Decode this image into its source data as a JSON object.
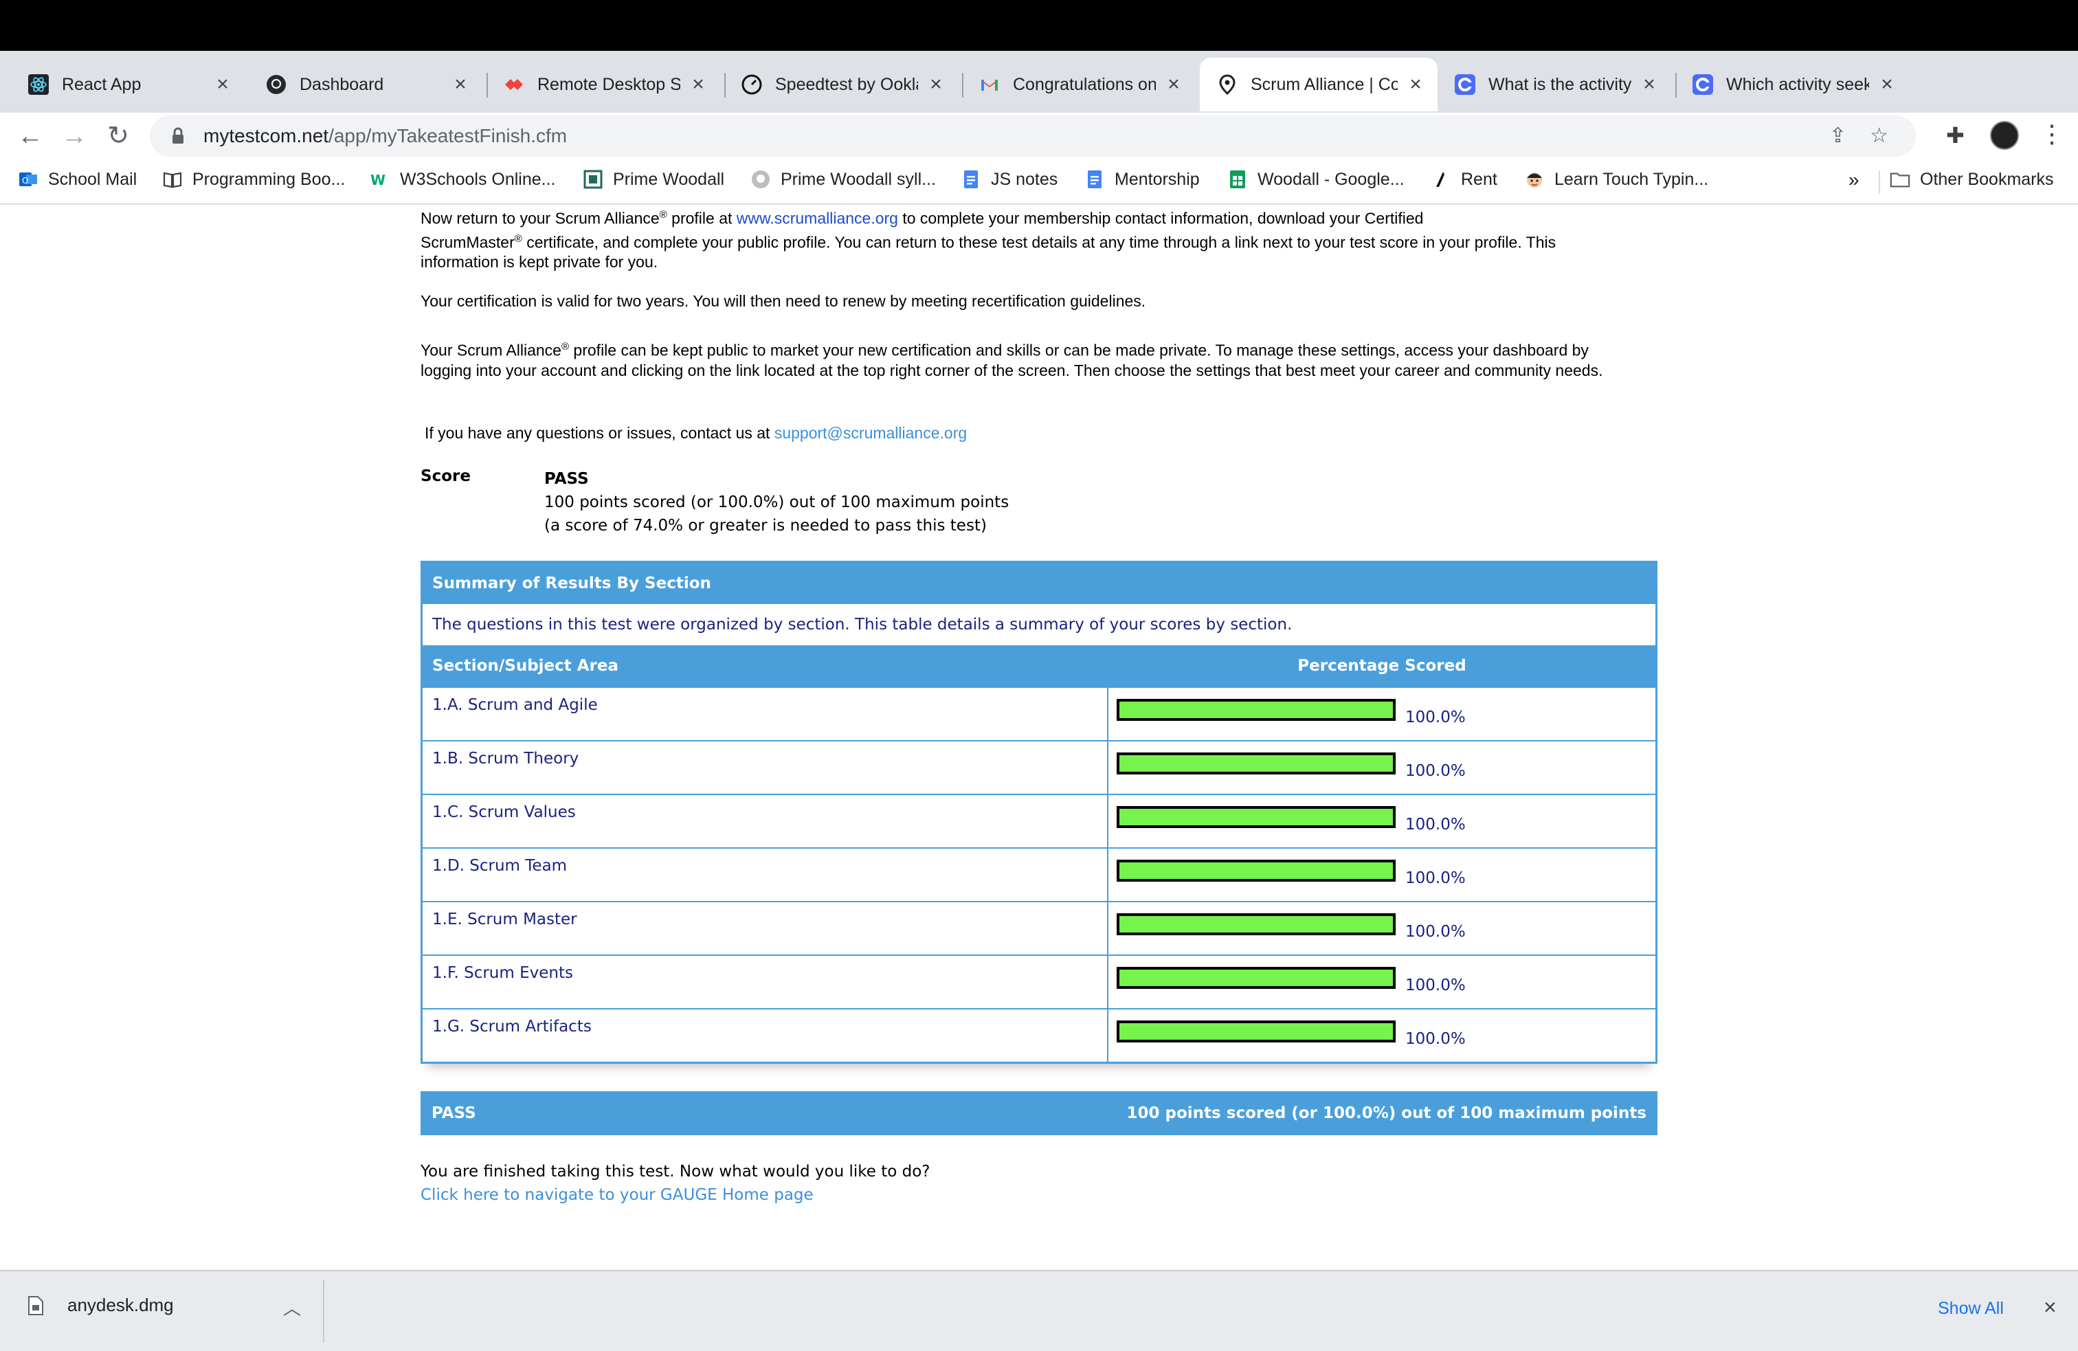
{
  "browser": {
    "tabs": [
      {
        "title": "React App",
        "icon": "react-icon"
      },
      {
        "title": "Dashboard",
        "icon": "github-icon"
      },
      {
        "title": "Remote Desktop So",
        "icon": "anydesk-icon"
      },
      {
        "title": "Speedtest by Ookla",
        "icon": "speedtest-icon"
      },
      {
        "title": "Congratulations on",
        "icon": "gmail-icon"
      },
      {
        "title": "Scrum Alliance | Co",
        "icon": "location-pin-icon",
        "active": true
      },
      {
        "title": "What is the activity",
        "icon": "chegg-icon"
      },
      {
        "title": "Which activity seek",
        "icon": "chegg-icon"
      }
    ],
    "url_host": "mytestcom.net",
    "url_path": "/app/myTakeatestFinish.cfm",
    "bookmarks": [
      {
        "label": "School Mail",
        "icon": "outlook-icon"
      },
      {
        "label": "Programming Boo...",
        "icon": "book-icon"
      },
      {
        "label": "W3Schools Online...",
        "icon": "w3schools-icon"
      },
      {
        "label": "Prime Woodall",
        "icon": "grid-icon"
      },
      {
        "label": "Prime Woodall syll...",
        "icon": "github-icon"
      },
      {
        "label": "JS notes",
        "icon": "docs-icon"
      },
      {
        "label": "Mentorship",
        "icon": "docs-icon"
      },
      {
        "label": "Woodall - Google...",
        "icon": "sheets-icon"
      },
      {
        "label": "Rent",
        "icon": "zillow-icon"
      },
      {
        "label": "Learn Touch Typin...",
        "icon": "typing-icon"
      }
    ],
    "bookmarks_overflow": "»",
    "other_bookmarks": "Other Bookmarks"
  },
  "content": {
    "para1": {
      "a": "Now return to your Scrum Alliance",
      "reg": "®",
      "b": " profile at ",
      "link": "www.scrumalliance.org",
      "c": " to complete your membership contact information, download your Certified",
      "d": "ScrumMaster",
      "e": " certificate, and complete your public profile. You can return to these test details at any time through a link next to your test score in your profile. This",
      "f": "information is kept private for you."
    },
    "para2": "Your certification is valid for two years. You will then need to renew by meeting recertification guidelines.",
    "para3": {
      "a": "Your Scrum Alliance",
      "b": " profile can be kept public to market your new certification and skills or can be made private. To manage these settings, access your dashboard by",
      "c": "logging into your account and clicking on the link located at the top right corner of the screen. Then choose the settings that best meet your career and community needs."
    },
    "contact_text": "If you have any questions or issues, contact us at ",
    "contact_email": "support@scrumalliance.org",
    "score": {
      "label": "Score",
      "status": "PASS",
      "detail": "100 points scored (or 100.0%) out of 100 maximum points",
      "threshold": "(a score of 74.0% or greater is needed to pass this test)"
    },
    "summary": {
      "title": "Summary of Results By Section",
      "description": "The questions in this test were organized by section. This table details a summary of your scores by section.",
      "col_section": "Section/Subject Area",
      "col_pct": "Percentage Scored",
      "rows": [
        {
          "section": "1.A. Scrum and Agile",
          "pct": "100.0%",
          "value": 1.0
        },
        {
          "section": "1.B. Scrum Theory",
          "pct": "100.0%",
          "value": 1.0
        },
        {
          "section": "1.C. Scrum Values",
          "pct": "100.0%",
          "value": 1.0
        },
        {
          "section": "1.D. Scrum Team",
          "pct": "100.0%",
          "value": 1.0
        },
        {
          "section": "1.E. Scrum Master",
          "pct": "100.0%",
          "value": 1.0
        },
        {
          "section": "1.F. Scrum Events",
          "pct": "100.0%",
          "value": 1.0
        },
        {
          "section": "1.G. Scrum Artifacts",
          "pct": "100.0%",
          "value": 1.0
        }
      ]
    },
    "pass_bar": {
      "status": "PASS",
      "detail": "100 points scored (or 100.0%) out of 100 maximum points"
    },
    "finish_text": "You are finished taking this test. Now what would you like to do?",
    "home_link": "Click here to navigate to your GAUGE Home page"
  },
  "downloads": {
    "filename": "anydesk.dmg",
    "show_all": "Show All"
  },
  "colors": {
    "header_blue": "#4a9fdb",
    "bar_green": "#76f34c",
    "text_navy": "#1a237e"
  }
}
